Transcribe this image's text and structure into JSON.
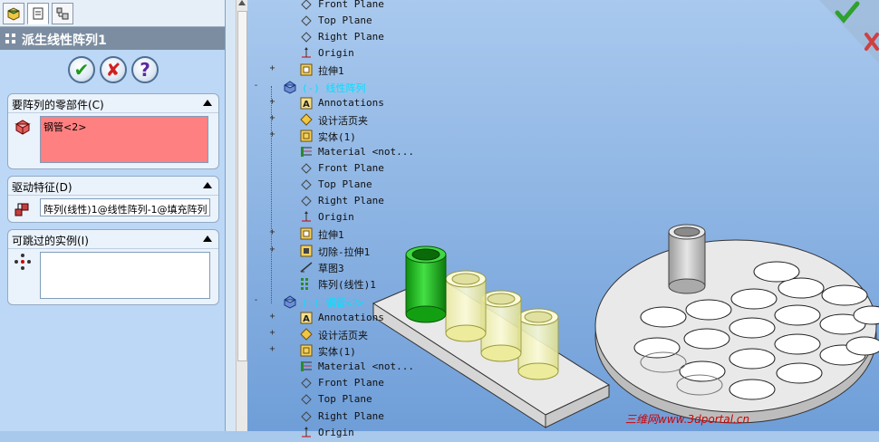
{
  "property_manager": {
    "title": "派生线性阵列1",
    "actions": {
      "ok": "✔",
      "cancel": "✘",
      "help": "?"
    },
    "groups": {
      "components": {
        "label": "要阵列的零部件(C)",
        "selection": "钢管<2>"
      },
      "driving_feature": {
        "label": "驱动特征(D)",
        "value": "阵列(线性)1@线性阵列-1@填充阵列"
      },
      "skip_instances": {
        "label": "可跳过的实例(I)",
        "value": ""
      }
    }
  },
  "tree": [
    {
      "label": "Front Plane",
      "icon": "plane-icon"
    },
    {
      "label": "Top Plane",
      "icon": "plane-icon"
    },
    {
      "label": "Right Plane",
      "icon": "plane-icon"
    },
    {
      "label": "Origin",
      "icon": "origin-icon"
    },
    {
      "label": "拉伸1",
      "icon": "extrude-icon"
    },
    {
      "label": "(-) 线性阵列",
      "icon": "part-icon"
    },
    {
      "label": "Annotations",
      "icon": "annotations-icon"
    },
    {
      "label": "设计活页夹",
      "icon": "design-binder-icon"
    },
    {
      "label": "实体(1)",
      "icon": "solid-bodies-icon"
    },
    {
      "label": "Material <not...",
      "icon": "material-icon"
    },
    {
      "label": "Front Plane",
      "icon": "plane-icon"
    },
    {
      "label": "Top Plane",
      "icon": "plane-icon"
    },
    {
      "label": "Right Plane",
      "icon": "plane-icon"
    },
    {
      "label": "Origin",
      "icon": "origin-icon"
    },
    {
      "label": "拉伸1",
      "icon": "extrude-icon"
    },
    {
      "label": "切除-拉伸1",
      "icon": "cut-extrude-icon"
    },
    {
      "label": "草图3",
      "icon": "sketch-icon"
    },
    {
      "label": "阵列(线性)1",
      "icon": "linear-pattern-icon"
    },
    {
      "label": "(-) 钢管<2>",
      "icon": "part-icon"
    },
    {
      "label": "Annotations",
      "icon": "annotations-icon"
    },
    {
      "label": "设计活页夹",
      "icon": "design-binder-icon"
    },
    {
      "label": "实体(1)",
      "icon": "solid-bodies-icon"
    },
    {
      "label": "Material <not...",
      "icon": "material-icon"
    },
    {
      "label": "Front Plane",
      "icon": "plane-icon"
    },
    {
      "label": "Top Plane",
      "icon": "plane-icon"
    },
    {
      "label": "Right Plane",
      "icon": "plane-icon"
    },
    {
      "label": "Origin",
      "icon": "origin-icon"
    }
  ],
  "watermark": "三维网www.3dportal.cn",
  "colors": {
    "viewport_bg": "#8cb4e4",
    "title_bar": "#7c8da1",
    "selection_box": "#ff8080",
    "tree_highlight": "#00e0ff",
    "tube_green": "#1fbf1f",
    "tube_preview": "#f4f4b0"
  }
}
